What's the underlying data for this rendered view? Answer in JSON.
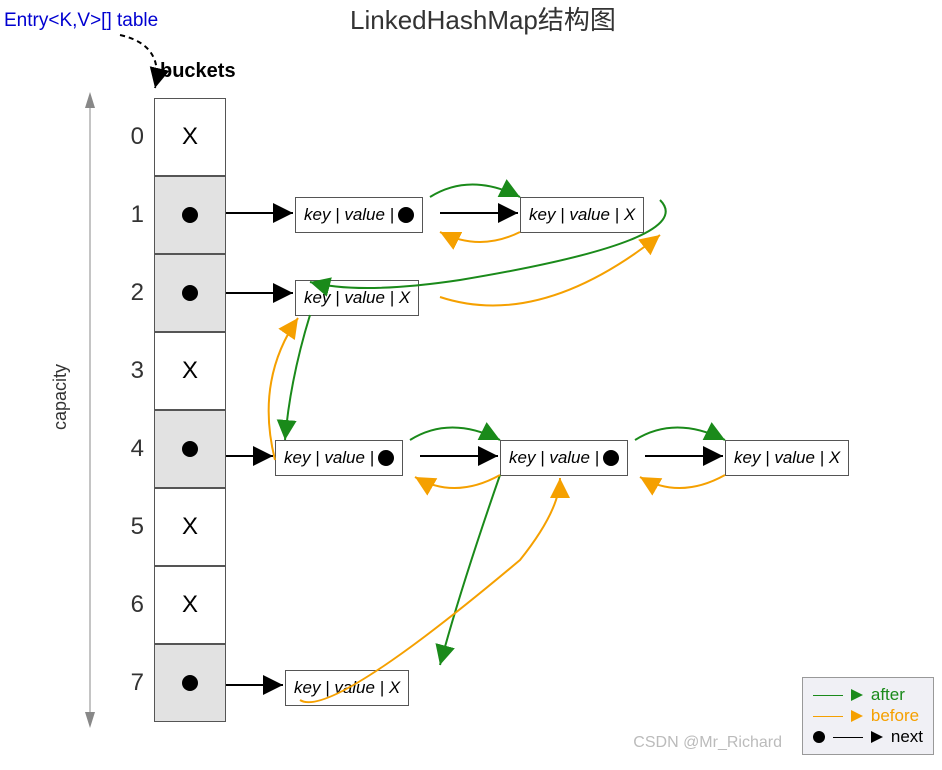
{
  "title": "LinkedHashMap结构图",
  "table_label": "Entry<K,V>[] table",
  "buckets_label": "buckets",
  "capacity_label": "capacity",
  "watermark": "CSDN @Mr_Richard",
  "buckets": [
    {
      "index": "0",
      "content": "X",
      "filled": false
    },
    {
      "index": "1",
      "content": "•",
      "filled": true
    },
    {
      "index": "2",
      "content": "•",
      "filled": true
    },
    {
      "index": "3",
      "content": "X",
      "filled": false
    },
    {
      "index": "4",
      "content": "•",
      "filled": true
    },
    {
      "index": "5",
      "content": "X",
      "filled": false
    },
    {
      "index": "6",
      "content": "X",
      "filled": false
    },
    {
      "index": "7",
      "content": "•",
      "filled": true
    }
  ],
  "nodes": {
    "n_1a": "key | value |",
    "n_1b": "key | value |  X",
    "n_2a": "key | value |  X",
    "n_4a": "key | value |",
    "n_4b": "key | value |",
    "n_4c": "key | value |  X",
    "n_7a": "key | value |  X"
  },
  "legend": {
    "after": {
      "label": "after",
      "color": "green"
    },
    "before": {
      "label": "before",
      "color": "orange"
    },
    "next": {
      "label": "next",
      "color": "black"
    }
  }
}
